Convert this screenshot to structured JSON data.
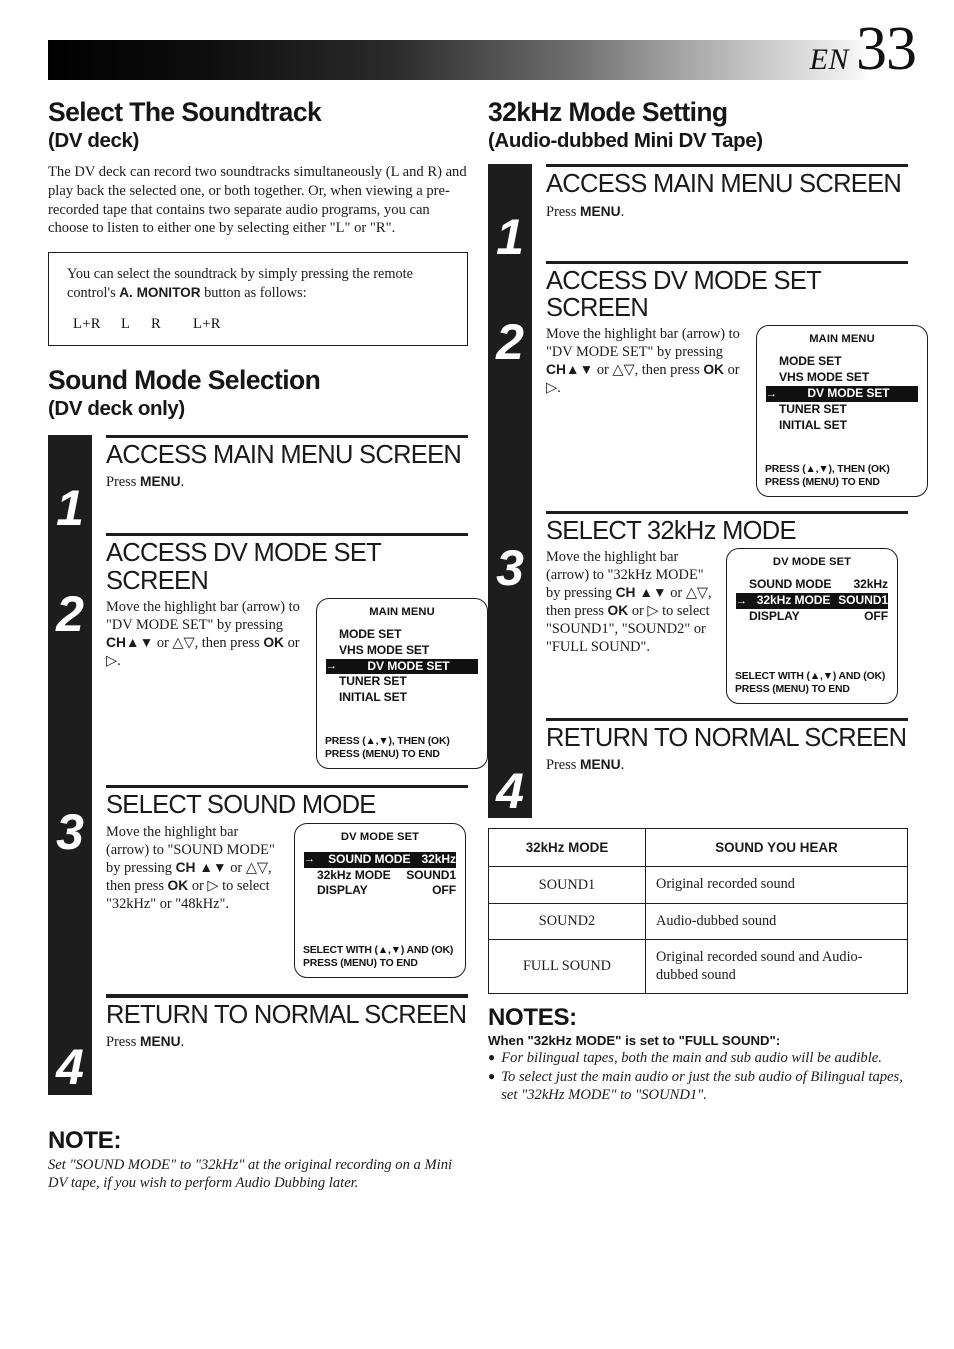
{
  "header": {
    "lang_code": "EN",
    "page_number": "33"
  },
  "left_column": {
    "section1": {
      "title": "Select The Soundtrack",
      "subtitle": "(DV deck)",
      "intro": "The DV deck can record two soundtracks simultaneously (L and R) and play back the selected one, or both together. Or, when viewing a pre-recorded tape that contains two separate audio programs, you can choose to listen to either one by selecting either \"L\" or \"R\".",
      "callout": {
        "text_before": "You can select the soundtrack by simply pressing the remote control's ",
        "bold_term": "A. MONITOR",
        "text_after": " button as follows:",
        "sequence": [
          "L+R",
          "L",
          "R",
          "L+R"
        ]
      }
    },
    "section2": {
      "title": "Sound Mode Selection",
      "subtitle": "(DV deck only)",
      "steps": [
        {
          "number": "1",
          "title": "ACCESS MAIN MENU SCREEN",
          "desc_pre": "Press ",
          "desc_bold": "MENU",
          "desc_post": "."
        },
        {
          "number": "2",
          "title": "ACCESS DV MODE SET SCREEN",
          "desc_html": "Move the highlight bar (arrow) to \"DV MODE SET\" by pressing <b>CH▲▼</b> or △▽, then press <b>OK</b> or ▷.",
          "osd": {
            "title": "MAIN MENU",
            "rows": [
              {
                "label": "MODE SET",
                "value": "",
                "highlighted": false
              },
              {
                "label": "VHS MODE SET",
                "value": "",
                "highlighted": false
              },
              {
                "label": "DV MODE SET",
                "value": "",
                "highlighted": true
              },
              {
                "label": "TUNER SET",
                "value": "",
                "highlighted": false
              },
              {
                "label": "INITIAL SET",
                "value": "",
                "highlighted": false
              }
            ],
            "footer_lines": [
              "PRESS (▲,▼), THEN (OK)",
              "PRESS (MENU) TO END"
            ]
          }
        },
        {
          "number": "3",
          "title": "SELECT SOUND MODE",
          "desc_html": "Move the highlight bar (arrow) to \"SOUND MODE\" by pressing <b>CH ▲▼</b> or △▽, then press <b>OK</b> or ▷ to select \"32kHz\" or \"48kHz\".",
          "osd": {
            "title": "DV MODE SET",
            "rows": [
              {
                "label": "SOUND MODE",
                "value": "32kHz",
                "highlighted": true
              },
              {
                "label": "32kHz MODE",
                "value": "SOUND1",
                "highlighted": false
              },
              {
                "label": "DISPLAY",
                "value": "OFF",
                "highlighted": false
              }
            ],
            "footer_lines": [
              "SELECT WITH (▲,▼) AND (OK)",
              "PRESS (MENU) TO END"
            ]
          }
        },
        {
          "number": "4",
          "title": "RETURN TO NORMAL SCREEN",
          "desc_pre": "Press ",
          "desc_bold": "MENU",
          "desc_post": "."
        }
      ]
    },
    "note": {
      "heading": "NOTE:",
      "body": "Set \"SOUND MODE\" to \"32kHz\" at the original recording on a Mini DV tape, if you wish to perform Audio Dubbing later."
    }
  },
  "right_column": {
    "section": {
      "title": "32kHz Mode Setting",
      "subtitle": "(Audio-dubbed Mini DV Tape)",
      "steps": [
        {
          "number": "1",
          "title": "ACCESS MAIN MENU SCREEN",
          "desc_pre": "Press ",
          "desc_bold": "MENU",
          "desc_post": "."
        },
        {
          "number": "2",
          "title": "ACCESS DV MODE SET SCREEN",
          "desc_html": "Move the highlight bar (arrow) to \"DV MODE SET\" by pressing <b>CH▲▼</b> or △▽, then press <b>OK</b> or ▷.",
          "osd": {
            "title": "MAIN MENU",
            "rows": [
              {
                "label": "MODE SET",
                "value": "",
                "highlighted": false
              },
              {
                "label": "VHS MODE SET",
                "value": "",
                "highlighted": false
              },
              {
                "label": "DV MODE SET",
                "value": "",
                "highlighted": true
              },
              {
                "label": "TUNER SET",
                "value": "",
                "highlighted": false
              },
              {
                "label": "INITIAL SET",
                "value": "",
                "highlighted": false
              }
            ],
            "footer_lines": [
              "PRESS (▲,▼), THEN (OK)",
              "PRESS (MENU) TO END"
            ]
          }
        },
        {
          "number": "3",
          "title": "SELECT 32kHz MODE",
          "desc_html": "Move the highlight bar (arrow) to \"32kHz MODE\" by pressing <b>CH ▲▼</b> or △▽, then press <b>OK</b> or ▷ to select \"SOUND1\", \"SOUND2\" or \"FULL SOUND\".",
          "osd": {
            "title": "DV MODE SET",
            "rows": [
              {
                "label": "SOUND MODE",
                "value": "32kHz",
                "highlighted": false
              },
              {
                "label": "32kHz MODE",
                "value": "SOUND1",
                "highlighted": true
              },
              {
                "label": "DISPLAY",
                "value": "OFF",
                "highlighted": false
              }
            ],
            "footer_lines": [
              "SELECT WITH (▲,▼) AND (OK)",
              "PRESS (MENU) TO END"
            ]
          }
        },
        {
          "number": "4",
          "title": "RETURN TO NORMAL SCREEN",
          "desc_pre": "Press ",
          "desc_bold": "MENU",
          "desc_post": "."
        }
      ]
    },
    "table": {
      "headers": [
        "32kHz MODE",
        "SOUND YOU HEAR"
      ],
      "rows": [
        [
          "SOUND1",
          "Original recorded sound"
        ],
        [
          "SOUND2",
          "Audio-dubbed sound"
        ],
        [
          "FULL SOUND",
          "Original recorded sound and Audio-dubbed sound"
        ]
      ]
    },
    "notes": {
      "heading": "NOTES:",
      "subheading": "When \"32kHz MODE\" is set to \"FULL SOUND\":",
      "bullets": [
        "For bilingual tapes, both the main and sub audio will be audible.",
        "To select just the main audio or just the sub audio of Bilingual tapes, set \"32kHz MODE\" to \"SOUND1\"."
      ]
    }
  },
  "colors": {
    "ink": "#1d1d1d",
    "paper": "#ffffff",
    "highlight_bg": "#111111",
    "highlight_fg": "#ffffff"
  }
}
